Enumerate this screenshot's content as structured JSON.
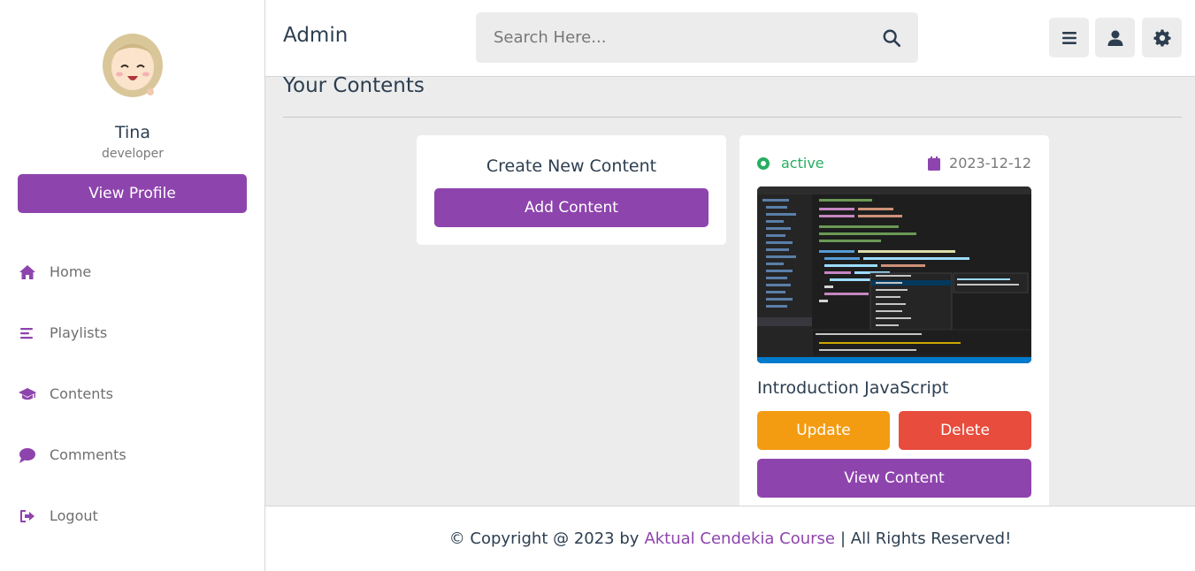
{
  "profile": {
    "name": "Tina",
    "role": "developer",
    "view_profile_label": "View Profile"
  },
  "nav": {
    "home": "Home",
    "playlists": "Playlists",
    "contents": "Contents",
    "comments": "Comments",
    "logout": "Logout"
  },
  "header": {
    "title": "Admin",
    "search_placeholder": "Search Here..."
  },
  "main": {
    "section_title": "Your Contents",
    "create_card": {
      "title": "Create New Content",
      "add_label": "Add Content"
    },
    "content_card": {
      "status": "active",
      "date": "2023-12-12",
      "title": "Introduction JavaScript",
      "update_label": "Update",
      "delete_label": "Delete",
      "view_label": "View Content"
    }
  },
  "footer": {
    "prefix": "© Copyright @ 2023 by",
    "brand": "Aktual Cendekia Course",
    "suffix": "| All Rights Reserved!"
  },
  "colors": {
    "accent": "#8e44ad",
    "update": "#f39c12",
    "delete": "#e74c3c",
    "active": "#27ae60"
  },
  "icons": [
    "home-icon",
    "list-icon",
    "graduation-cap-icon",
    "comment-icon",
    "logout-icon",
    "search-icon",
    "menu-icon",
    "user-icon",
    "gear-icon",
    "calendar-icon"
  ]
}
